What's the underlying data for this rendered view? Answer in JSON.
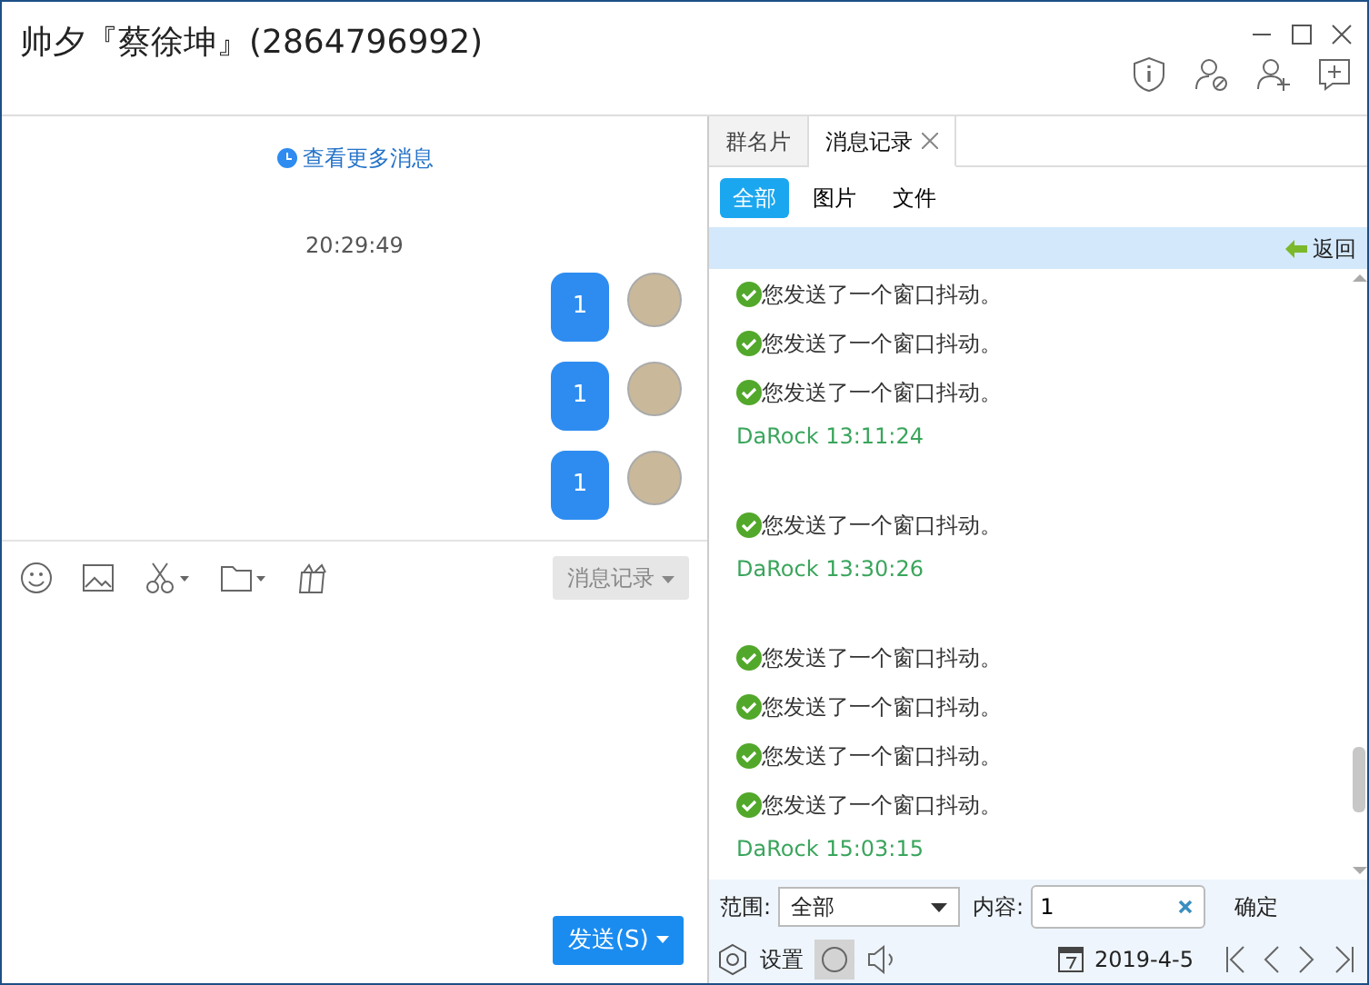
{
  "window": {
    "title": "帅夕『蔡徐坤』(2864796992)"
  },
  "chat": {
    "more_link": "查看更多消息",
    "timestamp": "20:29:49",
    "messages": [
      {
        "text": "1"
      },
      {
        "text": "1"
      },
      {
        "text": "1"
      }
    ],
    "history_button": "消息记录",
    "send_button": "发送(S)"
  },
  "side_tabs": [
    {
      "label": "群名片",
      "selected": false,
      "closable": false
    },
    {
      "label": "消息记录",
      "selected": true,
      "closable": true
    }
  ],
  "filters": [
    {
      "label": "全部",
      "selected": true
    },
    {
      "label": "图片",
      "selected": false
    },
    {
      "label": "文件",
      "selected": false
    }
  ],
  "back_link": "返回",
  "records": [
    {
      "kind": "event",
      "text": "您发送了一个窗口抖动。"
    },
    {
      "kind": "event",
      "text": "您发送了一个窗口抖动。"
    },
    {
      "kind": "event",
      "text": "您发送了一个窗口抖动。"
    },
    {
      "kind": "sender",
      "text": "DaRock 13:11:24"
    },
    {
      "kind": "gap"
    },
    {
      "kind": "event",
      "text": "您发送了一个窗口抖动。"
    },
    {
      "kind": "sender",
      "text": "DaRock 13:30:26"
    },
    {
      "kind": "gap"
    },
    {
      "kind": "event",
      "text": "您发送了一个窗口抖动。"
    },
    {
      "kind": "event",
      "text": "您发送了一个窗口抖动。"
    },
    {
      "kind": "event",
      "text": "您发送了一个窗口抖动。"
    },
    {
      "kind": "event",
      "text": "您发送了一个窗口抖动。"
    },
    {
      "kind": "sender",
      "text": "DaRock 15:03:15"
    }
  ],
  "search": {
    "scope_label": "范围:",
    "scope_value": "全部",
    "content_label": "内容:",
    "content_value": "1",
    "confirm": "确定"
  },
  "footer": {
    "settings": "设置",
    "search_on": true,
    "date": "2019-4-5"
  }
}
